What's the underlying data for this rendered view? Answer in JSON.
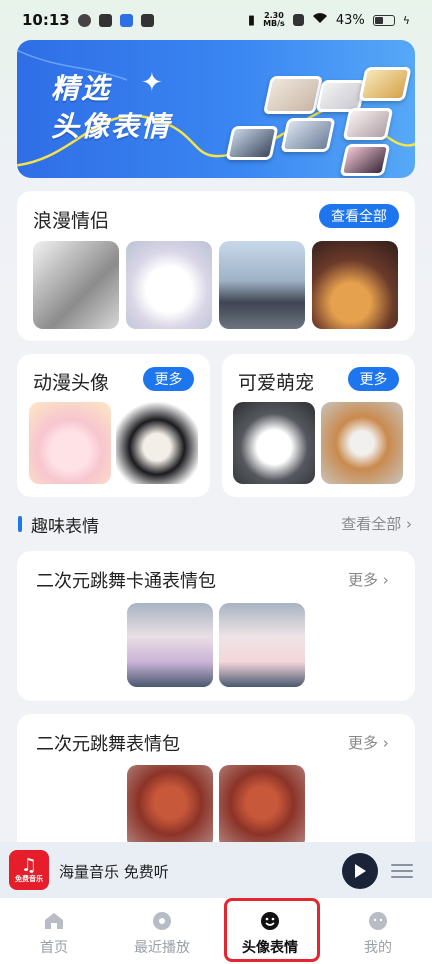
{
  "status_bar": {
    "time": "10:13",
    "net_speed_top": "2.30",
    "net_speed_bottom": "MB/s",
    "battery": "43%"
  },
  "banner": {
    "line1": "精选",
    "line2": "头像表情"
  },
  "romance": {
    "title": "浪漫情侣",
    "button": "查看全部"
  },
  "anime": {
    "title": "动漫头像",
    "button": "更多"
  },
  "pets": {
    "title": "可爱萌宠",
    "button": "更多"
  },
  "fun": {
    "title": "趣味表情",
    "more": "查看全部 ›"
  },
  "packs": [
    {
      "title": "二次元跳舞卡通表情包",
      "more": "更多 ›"
    },
    {
      "title": "二次元跳舞表情包",
      "more": "更多 ›"
    }
  ],
  "player": {
    "logo_label": "免费音乐",
    "text": "海量音乐 免费听"
  },
  "nav": [
    {
      "label": "首页"
    },
    {
      "label": "最近播放"
    },
    {
      "label": "头像表情"
    },
    {
      "label": "我的"
    }
  ],
  "colors": {
    "accent": "#1e76ee",
    "active_outline": "#e3262f"
  }
}
